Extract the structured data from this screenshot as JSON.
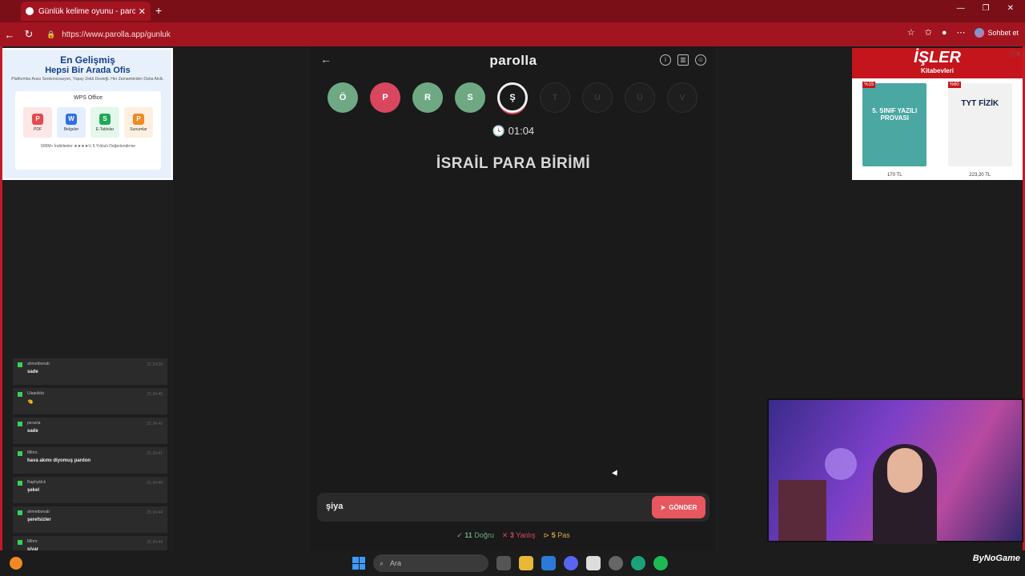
{
  "browser": {
    "tab_title": "Günlük kelime oyunu - parolla",
    "url": "https://www.parolla.app/gunluk",
    "copilot_label": "Sohbet et"
  },
  "ad_left": {
    "headline1": "En Gelişmiş",
    "headline2": "Hepsi Bir Arada Ofis",
    "subtitle": "Platformlar Arası Senkronizasyon, Yapay Zekâ Desteği. Her Zamankinden Daha Akıllı.",
    "product": "WPS Office",
    "apps": [
      "PDF",
      "Belgeler",
      "E-Tablolar",
      "Sunumlar"
    ],
    "footer": "500M+ İndirilenler   ★★★★½ 5 Yıldızlı Değerlendirme"
  },
  "chat": [
    {
      "user": "ahmetbonab",
      "time": "21:24:39",
      "text": "sade"
    },
    {
      "user": "Ulaanlida",
      "time": "21:24:45",
      "text": "🤏"
    },
    {
      "user": "peravia",
      "time": "21:24:40",
      "text": "sade"
    },
    {
      "user": "Mihro",
      "time": "21:24:41",
      "text": "hava akımı diyomuş pardon"
    },
    {
      "user": "Raphyklck",
      "time": "21:24:49",
      "text": "şekel"
    },
    {
      "user": "ahmetbonab",
      "time": "21:24:44",
      "text": "şerefsizler"
    },
    {
      "user": "Mihro",
      "time": "21:24:44",
      "text": "şiyar"
    }
  ],
  "game": {
    "logo": "parolla",
    "letters": [
      {
        "char": "Ö",
        "state": "correct"
      },
      {
        "char": "P",
        "state": "wrong"
      },
      {
        "char": "R",
        "state": "correct"
      },
      {
        "char": "S",
        "state": "correct"
      },
      {
        "char": "Ş",
        "state": "current"
      },
      {
        "char": "T",
        "state": "empty"
      },
      {
        "char": "U",
        "state": "empty"
      },
      {
        "char": "Ü",
        "state": "empty"
      },
      {
        "char": "V",
        "state": "empty"
      }
    ],
    "timer": "01:04",
    "clue": "İSRAİL PARA BİRİMİ",
    "answer_value": "şiya",
    "send_label": "GÖNDER",
    "stats": {
      "correct_count": "11",
      "correct_label": "Doğru",
      "wrong_count": "3",
      "wrong_label": "Yanlış",
      "pass_count": "5",
      "pass_label": "Pas"
    }
  },
  "ad_right": {
    "brand": "İŞLER",
    "brand_sub": "Kitabevleri",
    "books": [
      {
        "discount": "%15",
        "title": "5. SINIF YAZILI PROVASI",
        "price": "170 TL"
      },
      {
        "discount": "%60",
        "title": "TYT FİZİK",
        "price": "223,20 TL"
      }
    ]
  },
  "taskbar": {
    "search_placeholder": "Ara",
    "brand": "ByNoGame"
  },
  "colors": {
    "correct": "#6ea983",
    "wrong": "#d9475e",
    "pass": "#d8a84a",
    "accent_red": "#c3192a"
  }
}
